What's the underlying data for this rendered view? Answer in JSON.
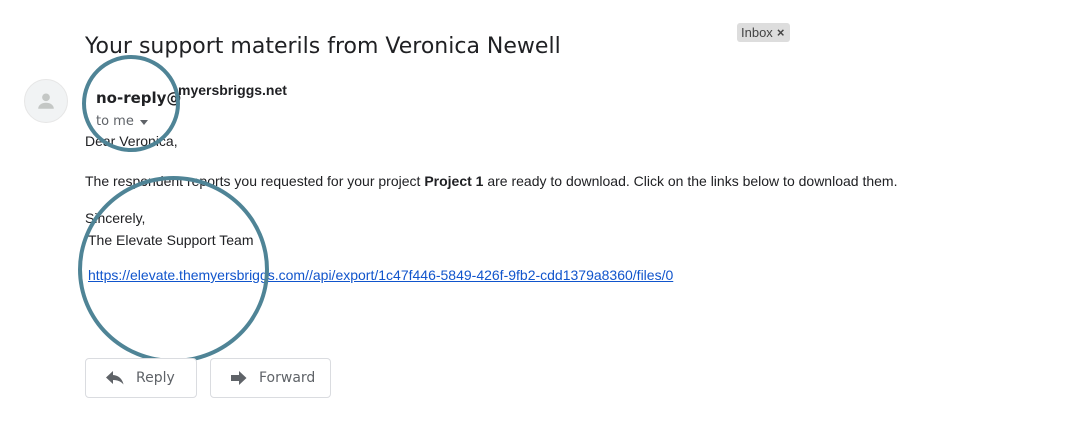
{
  "email": {
    "subject": "Your support materils from Veronica Newell",
    "label": "Inbox",
    "label_close": "×",
    "sender": {
      "name": "no-reply@",
      "domain": "myersbriggs.net",
      "to_label": "to me"
    },
    "body": {
      "greeting": "Dear Veronica,",
      "message_before": "The respondent reports you requested for your project ",
      "project_name": "Project 1",
      "message_after": " are ready to download. Click on the links below to download them.",
      "closing": "Sincerely,",
      "team": "The Elevate Support Team",
      "link": "https://elevate.themyersbriggs.com//api/export/1c47f446-5849-426f-9fb2-cdd1379a8360/files/0"
    },
    "actions": {
      "reply_label": "Reply",
      "forward_label": "Forward"
    }
  },
  "icons": {
    "avatar": "person-icon",
    "reply": "reply-arrow-icon",
    "forward": "forward-arrow-icon",
    "dropdown": "chevron-down-icon"
  },
  "colors": {
    "highlight_circle": "#4f8496",
    "link": "#1155cc",
    "label_chip": "#dddddd"
  }
}
